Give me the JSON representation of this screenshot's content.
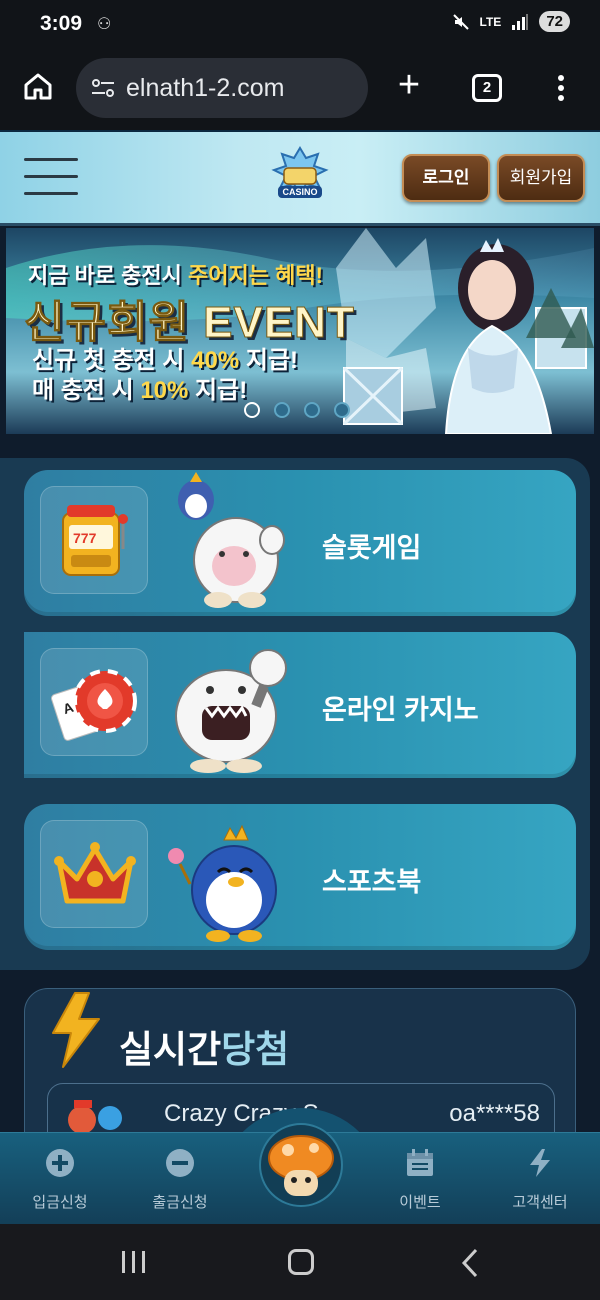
{
  "status_bar": {
    "time": "3:09",
    "network": "LTE",
    "battery": "72"
  },
  "browser": {
    "url": "elnath1-2.com",
    "tab_count": "2"
  },
  "header": {
    "logo_text": "CASINO",
    "login_label": "로그인",
    "join_label": "회원가입"
  },
  "banner": {
    "line1_a": "지금 바로 충전시 ",
    "line1_b": "주어지는 혜택!",
    "line2": "신규회원 EVENT",
    "line3_a": "신규 첫 충전 시 ",
    "line3_b": "40%",
    "line3_c": " 지급!",
    "line4_a": "매 충전 시 ",
    "line4_b": "10%",
    "line4_c": " 지급!",
    "active_slide": 1,
    "slide_count": 4
  },
  "games": [
    {
      "label": "슬롯게임",
      "icon": "slot-machine-icon"
    },
    {
      "label": "온라인 카지노",
      "icon": "casino-chip-cards-icon"
    },
    {
      "label": "스포츠북",
      "icon": "crown-icon"
    }
  ],
  "live_wins": {
    "title_bold": "실시간",
    "title_light": "당첨",
    "rows": [
      {
        "game": "Crazy Crazy S",
        "user": "oa****58"
      }
    ]
  },
  "bottom_nav": [
    {
      "label": "입금신청",
      "icon": "plus-circle-icon"
    },
    {
      "label": "출금신청",
      "icon": "minus-circle-icon"
    },
    {
      "label": "",
      "icon": "mushroom-mascot-icon"
    },
    {
      "label": "이벤트",
      "icon": "calendar-icon"
    },
    {
      "label": "고객센터",
      "icon": "lightning-icon"
    }
  ],
  "colors": {
    "accent_teal": "#2a91b0",
    "panel_bg": "#193a52",
    "button_brown": "#5e3818",
    "highlight_yellow": "#ffd84a"
  }
}
